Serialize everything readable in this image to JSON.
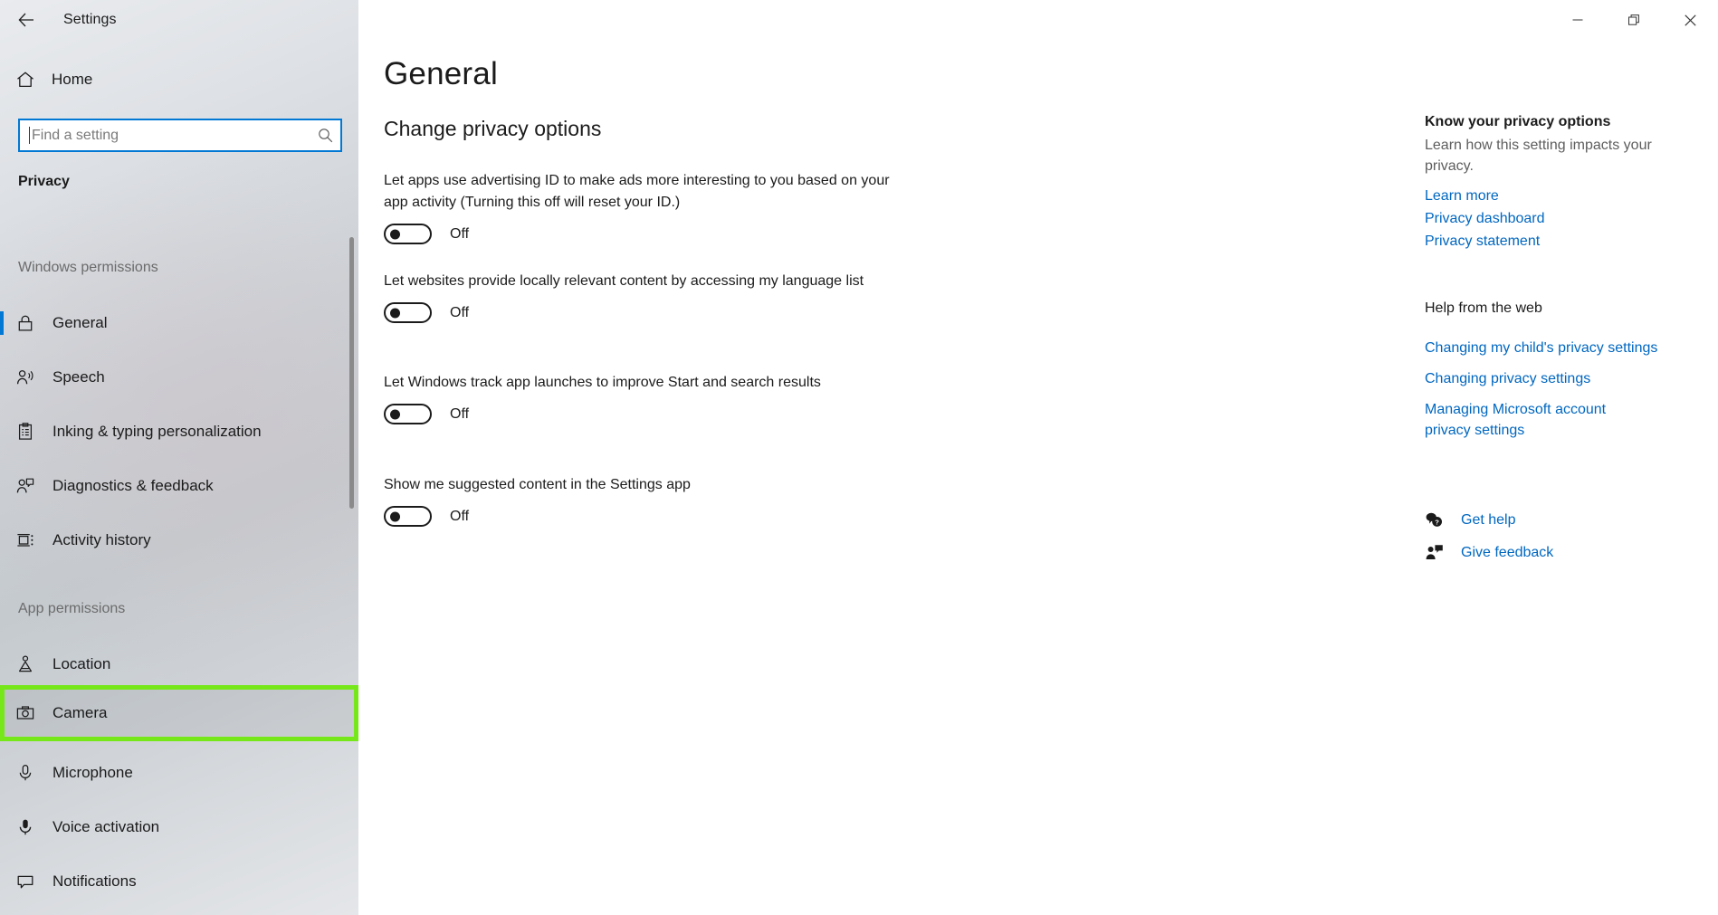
{
  "window": {
    "title": "Settings",
    "back_icon": "back-arrow-icon",
    "minimize_label": "—",
    "maximize_label": "restore-icon",
    "close_label": "✕"
  },
  "sidebar": {
    "home_label": "Home",
    "home_icon": "home-icon",
    "search": {
      "placeholder": "Find a setting",
      "value": "",
      "icon": "search-icon"
    },
    "category": "Privacy",
    "groups": [
      {
        "heading": "Windows permissions",
        "items": [
          {
            "label": "General",
            "icon": "lock-icon",
            "selected": true
          },
          {
            "label": "Speech",
            "icon": "speech-person-icon",
            "selected": false
          },
          {
            "label": "Inking & typing personalization",
            "icon": "clipboard-pen-icon",
            "selected": false
          },
          {
            "label": "Diagnostics & feedback",
            "icon": "person-feedback-icon",
            "selected": false
          },
          {
            "label": "Activity history",
            "icon": "activity-history-icon",
            "selected": false
          }
        ]
      },
      {
        "heading": "App permissions",
        "items": [
          {
            "label": "Location",
            "icon": "location-pin-icon",
            "selected": false
          },
          {
            "label": "Camera",
            "icon": "camera-icon",
            "selected": false,
            "highlighted": true
          },
          {
            "label": "Microphone",
            "icon": "microphone-icon",
            "selected": false
          },
          {
            "label": "Voice activation",
            "icon": "voice-activation-icon",
            "selected": false
          },
          {
            "label": "Notifications",
            "icon": "notification-bubble-icon",
            "selected": false
          }
        ]
      }
    ],
    "highlight_color": "#76e719",
    "accent_color": "#0078d4"
  },
  "main": {
    "page_title": "General",
    "section_title": "Change privacy options",
    "settings": [
      {
        "description": "Let apps use advertising ID to make ads more interesting to you based on your app activity (Turning this off will reset your ID.)",
        "state": "Off",
        "on": false
      },
      {
        "description": "Let websites provide locally relevant content by accessing my language list",
        "state": "Off",
        "on": false
      },
      {
        "description": "Let Windows track app launches to improve Start and search results",
        "state": "Off",
        "on": false
      },
      {
        "description": "Show me suggested content in the Settings app",
        "state": "Off",
        "on": false
      }
    ]
  },
  "right_panel": {
    "privacy_heading": "Know your privacy options",
    "privacy_sub": "Learn how this setting impacts your privacy.",
    "privacy_links": [
      "Learn more",
      "Privacy dashboard",
      "Privacy statement"
    ],
    "web_heading": "Help from the web",
    "web_links": [
      "Changing my child's privacy settings",
      "Changing privacy settings",
      "Managing Microsoft account privacy settings"
    ],
    "actions": [
      {
        "label": "Get help",
        "icon": "question-bubble-icon"
      },
      {
        "label": "Give feedback",
        "icon": "feedback-person-icon"
      }
    ],
    "link_color": "#0067c0"
  }
}
